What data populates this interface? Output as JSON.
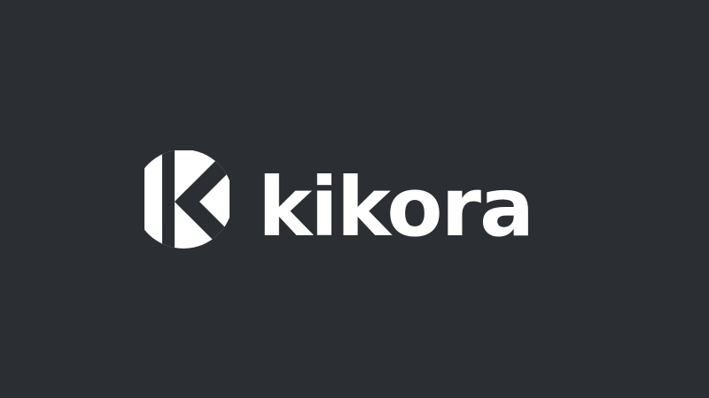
{
  "brand": {
    "name": "kikora",
    "logo_icon": "kikora-k-circle-icon"
  },
  "colors": {
    "background": "#2b2e33",
    "logo": "#ffffff"
  }
}
